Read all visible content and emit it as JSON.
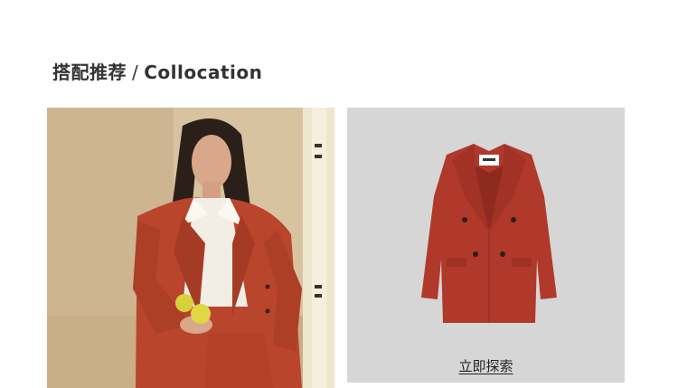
{
  "section": {
    "title_cn": "搭配推荐",
    "separator": "/",
    "title_en": "Collocation"
  },
  "model_photo": {
    "jacket_color": "#b8452c",
    "shirt_color": "#f2eee6",
    "background_color": "#d9c4a3",
    "fruit_color": "#d8d23a"
  },
  "product_card": {
    "background_color": "#d6d6d6",
    "jacket_color": "#b0392c",
    "explore_label": "立即探索"
  }
}
